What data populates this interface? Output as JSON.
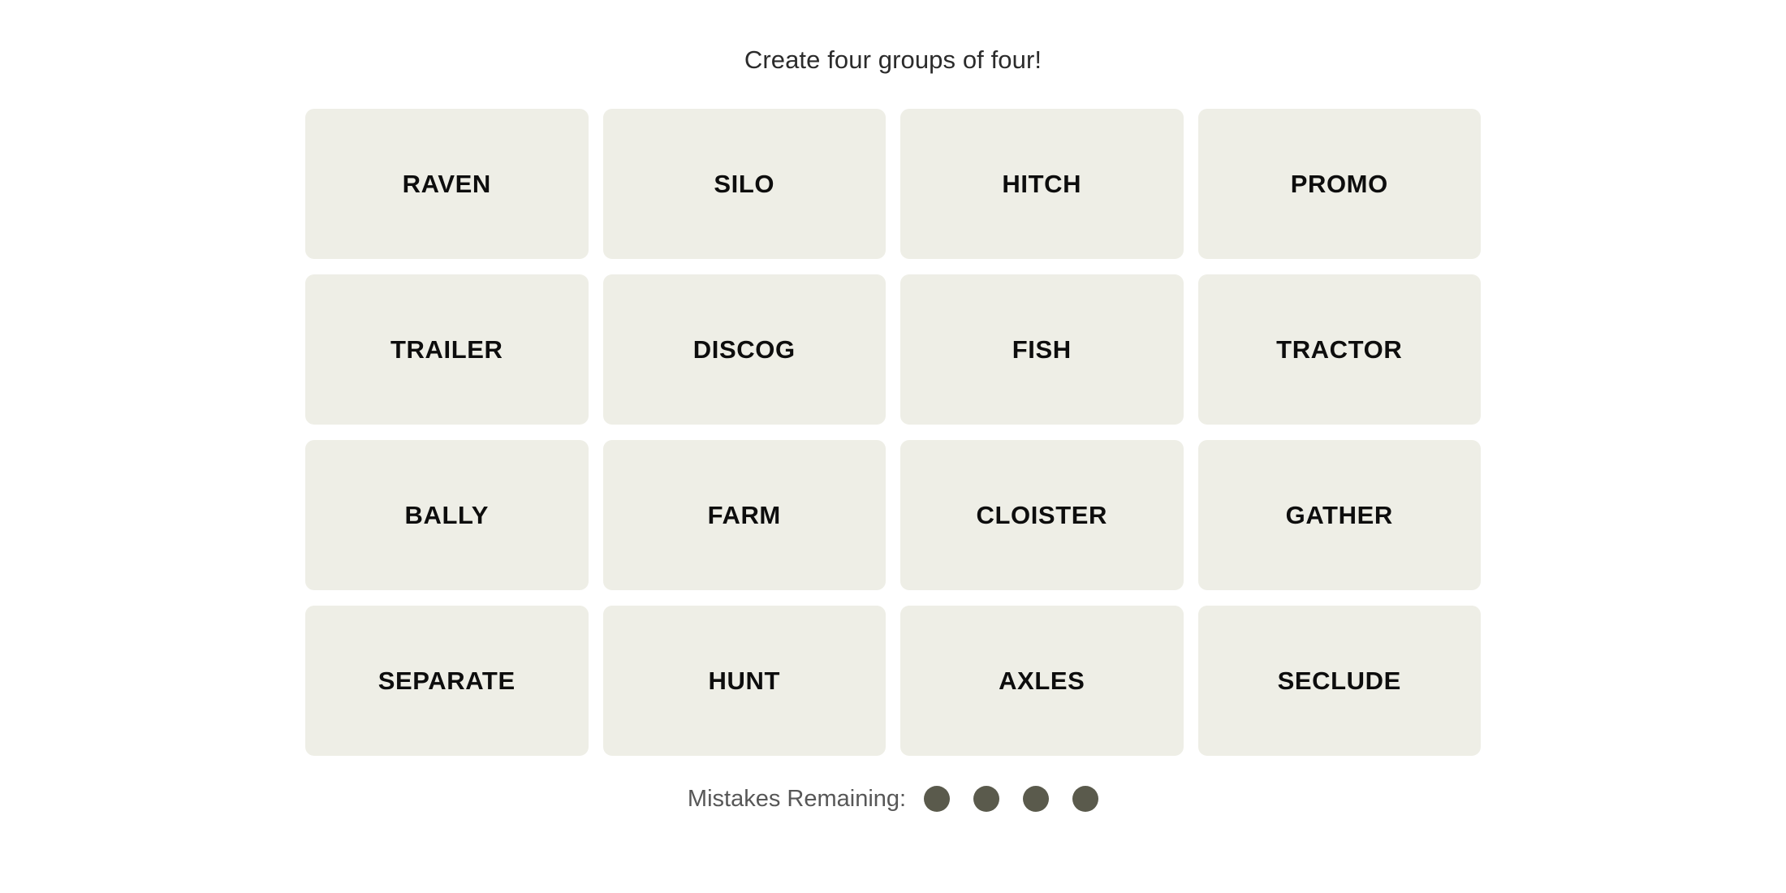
{
  "game": {
    "title": "Create four groups of four!",
    "board": {
      "rows": [
        [
          "RAVEN",
          "SILO",
          "HITCH",
          "PROMO"
        ],
        [
          "TRAILER",
          "DISCOG",
          "FISH",
          "TRACTOR"
        ],
        [
          "BALLY",
          "FARM",
          "CLOISTER",
          "GATHER"
        ],
        [
          "SEPARATE",
          "HUNT",
          "AXLES",
          "SECLUDE"
        ]
      ],
      "tile_background_color": "#EEEEE6",
      "tile_text_color": "#0D0D0D"
    },
    "footer": {
      "mistakes_label": "Mistakes Remaining:",
      "mistakes_remaining": 4,
      "dot_color": "#5A5A4C",
      "label_color": "#575757"
    },
    "page_background_color": "#FFFFFF"
  }
}
